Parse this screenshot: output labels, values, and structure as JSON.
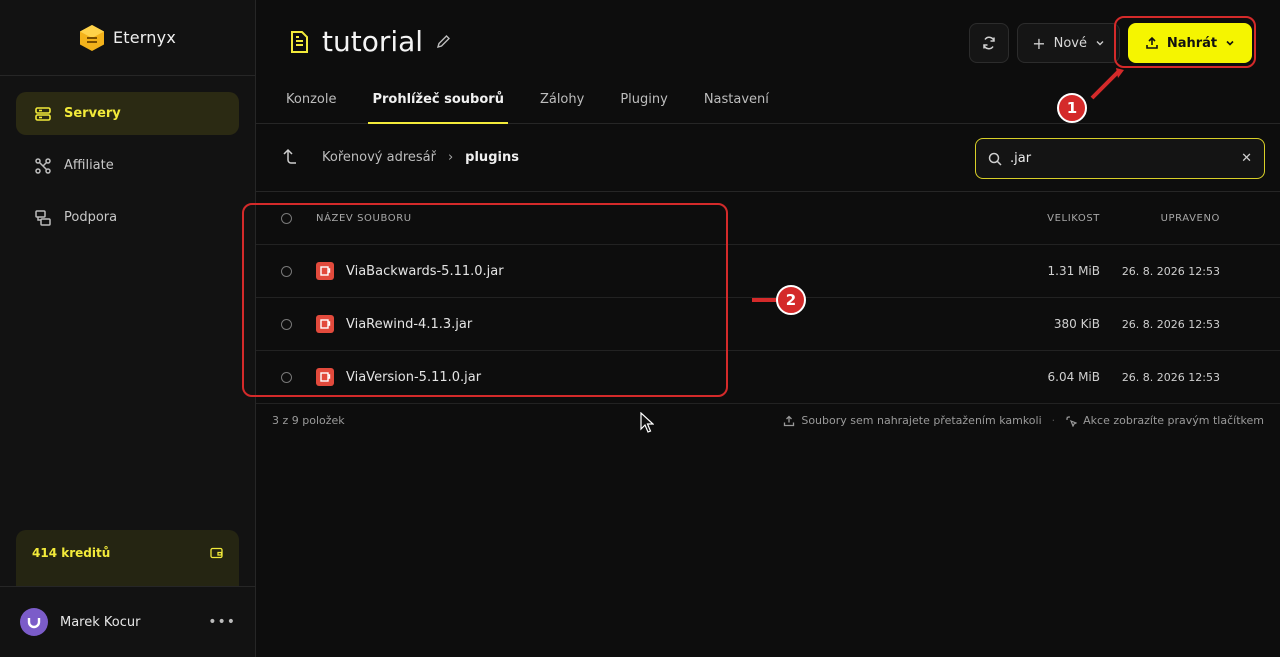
{
  "brand": {
    "name": "Eternyx"
  },
  "sidebar": {
    "items": [
      {
        "label": "Servery",
        "icon": "server-icon",
        "active": true
      },
      {
        "label": "Affiliate",
        "icon": "affiliate-icon",
        "active": false
      },
      {
        "label": "Podpora",
        "icon": "support-icon",
        "active": false
      }
    ],
    "credits": "414 kreditů",
    "user": {
      "name": "Marek Kocur"
    }
  },
  "header": {
    "title": "tutorial",
    "new_label": "Nové",
    "upload_label": "Nahrát",
    "tabs": [
      "Konzole",
      "Prohlížeč souborů",
      "Zálohy",
      "Pluginy",
      "Nastavení"
    ]
  },
  "path": {
    "root": "Kořenový adresář",
    "current": "plugins"
  },
  "search": {
    "value": ".jar"
  },
  "table": {
    "headers": {
      "name": "NÁZEV SOUBORU",
      "size": "VELIKOST",
      "modified": "UPRAVENO"
    },
    "rows": [
      {
        "name": "ViaBackwards-5.11.0.jar",
        "size": "1.31 MiB",
        "modified": "26. 8. 2026 12:53"
      },
      {
        "name": "ViaRewind-4.1.3.jar",
        "size": "380 KiB",
        "modified": "26. 8. 2026 12:53"
      },
      {
        "name": "ViaVersion-5.11.0.jar",
        "size": "6.04 MiB",
        "modified": "26. 8. 2026 12:53"
      }
    ]
  },
  "footer": {
    "count": "3 z 9 položek",
    "hint_upload": "Soubory sem nahrajete přetažením kamkoli",
    "hint_actions": "Akce zobrazíte pravým tlačítkem"
  },
  "annotations": {
    "badge1": "1",
    "badge2": "2"
  },
  "colors": {
    "accent": "#f5f500",
    "annotation": "#d42a2a",
    "file_icon": "#e24a3c"
  }
}
